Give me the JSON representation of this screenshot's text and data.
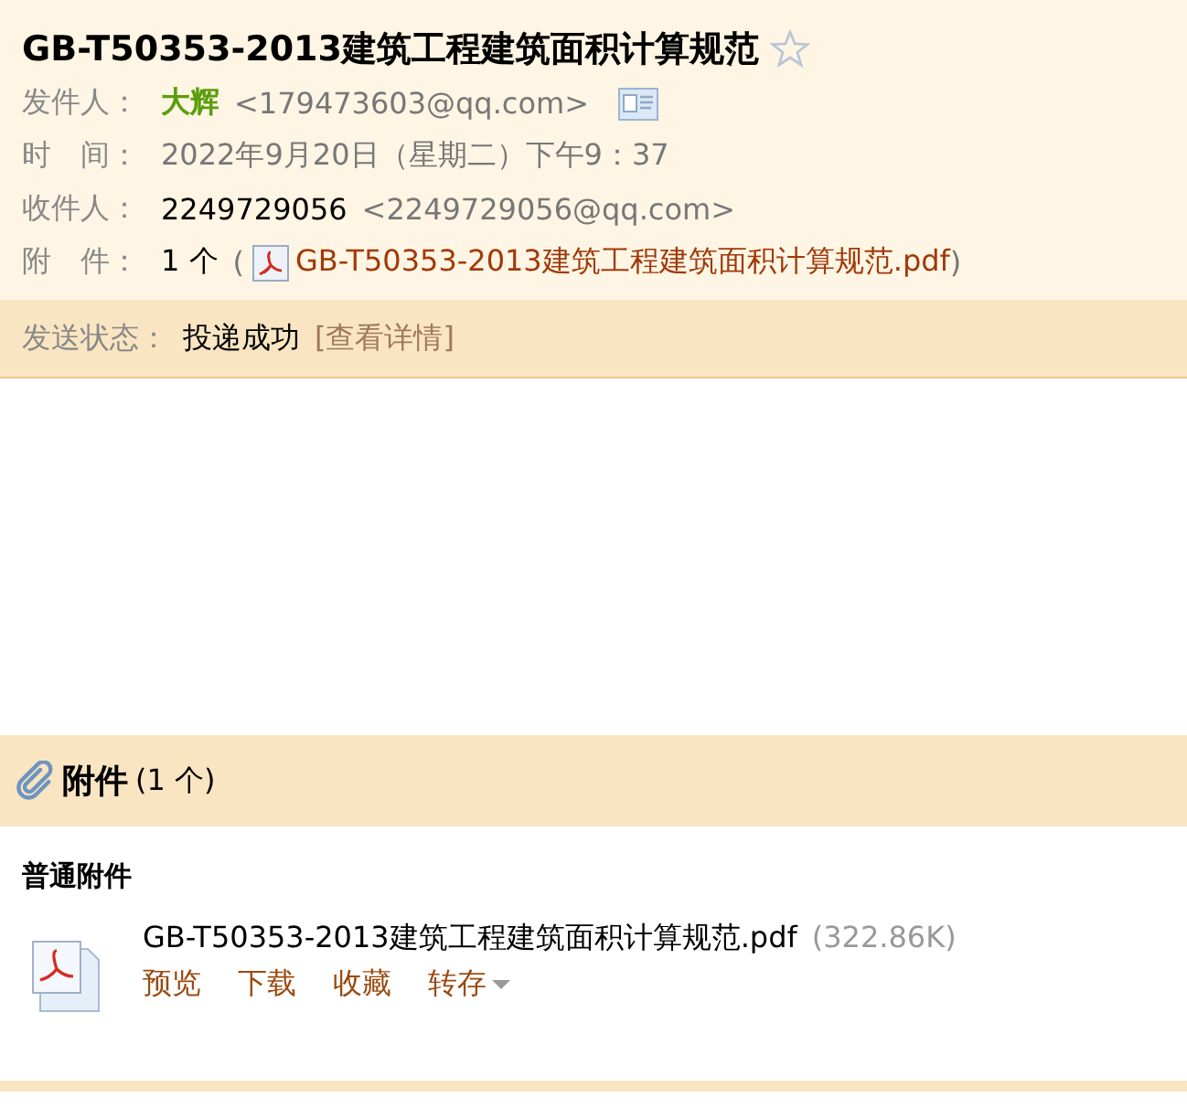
{
  "email": {
    "title": "GB-T50353-2013建筑工程建筑面积计算规范",
    "starred": false,
    "fields": [
      {
        "kind": "sender",
        "label": "发件人：",
        "name": "大辉",
        "address": "<179473603@qq.com>"
      },
      {
        "kind": "time",
        "label": "时　间：",
        "value": "2022年9月20日（星期二）下午9：37"
      },
      {
        "kind": "recipient",
        "label": "收件人：",
        "name": "2249729056",
        "address": "<2249729056@qq.com>"
      },
      {
        "kind": "attachment",
        "label": "附　件：",
        "count": "1 个",
        "open": "(",
        "file": "GB-T50353-2013建筑工程建筑面积计算规范.pdf",
        "close": ")"
      }
    ],
    "status": {
      "label": "发送状态：",
      "value": "投递成功",
      "link": "[查看详情]"
    }
  },
  "attachments": {
    "title": "附件",
    "count": "(1 个)",
    "group": "普通附件",
    "files": [
      {
        "name": "GB-T50353-2013建筑工程建筑面积计算规范.pdf",
        "size": "(322.86K)",
        "actions": [
          {
            "label": "预览",
            "kind": "link"
          },
          {
            "label": "下载",
            "kind": "link"
          },
          {
            "label": "收藏",
            "kind": "link"
          },
          {
            "label": "转存",
            "kind": "menu"
          }
        ]
      }
    ]
  }
}
